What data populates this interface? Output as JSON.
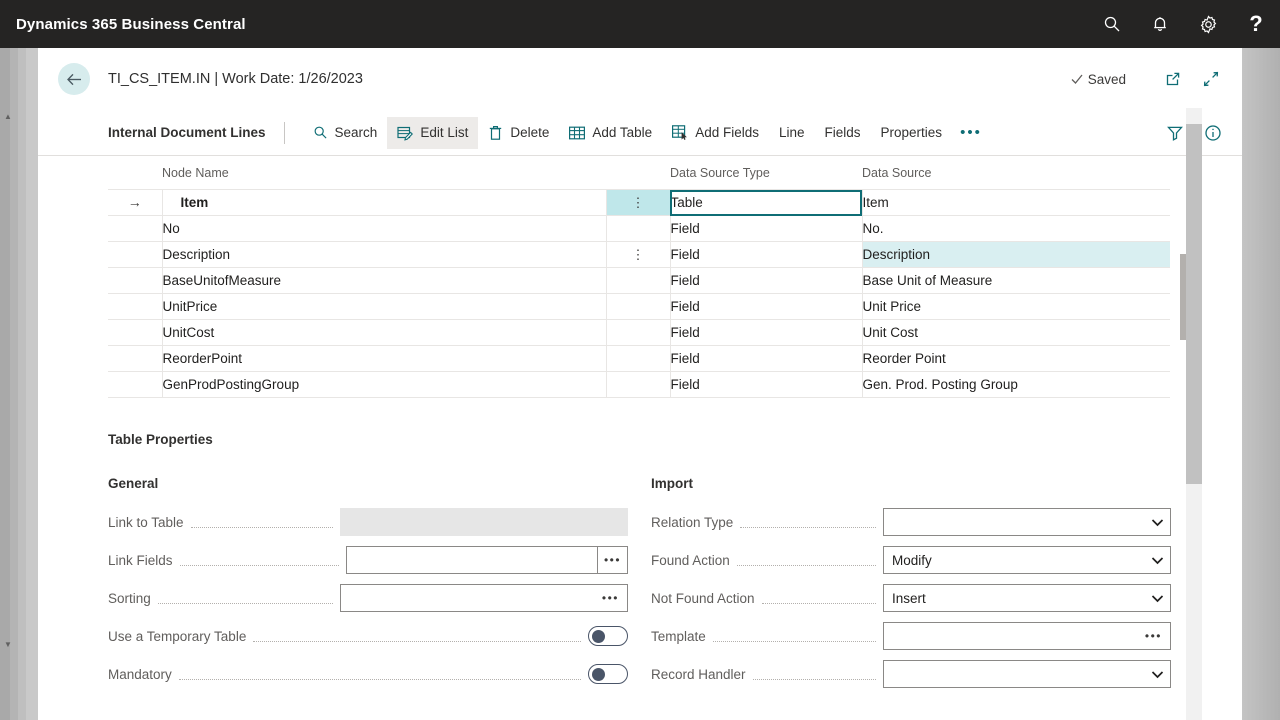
{
  "app": {
    "title": "Dynamics 365 Business Central",
    "actions": [
      {
        "name": "search-icon",
        "label": "Search"
      },
      {
        "name": "notification-bell-icon",
        "label": "Notifications"
      },
      {
        "name": "settings-gear-icon",
        "label": "Settings"
      },
      {
        "name": "help-icon",
        "label": "?"
      }
    ]
  },
  "header": {
    "back_label": "Back",
    "caption": "TI_CS_ITEM.IN | Work Date: 1/26/2023",
    "saved_label": "Saved",
    "open_new_window_label": "Open in new window",
    "collapse_label": "Collapse"
  },
  "ribbon": {
    "title": "Internal Document Lines",
    "items": [
      {
        "label": "Search",
        "icon": "search-icon",
        "active": false
      },
      {
        "label": "Edit List",
        "icon": "edit-list-icon",
        "active": true
      },
      {
        "label": "Delete",
        "icon": "trash-icon",
        "active": false
      },
      {
        "label": "Add Table",
        "icon": "table-grid-icon",
        "active": false
      },
      {
        "label": "Add Fields",
        "icon": "add-fields-icon",
        "active": false
      },
      {
        "label": "Line",
        "icon": "",
        "active": false
      },
      {
        "label": "Fields",
        "icon": "",
        "active": false
      },
      {
        "label": "Properties",
        "icon": "",
        "active": false
      }
    ],
    "overflow_label": "•••",
    "filter_label": "Filter",
    "info_label": "Info"
  },
  "grid": {
    "columns": [
      "Node Name",
      "Data Source Type",
      "Data Source"
    ],
    "rows": [
      {
        "node": "Item",
        "type": "Table",
        "source": "Item",
        "level": 0,
        "selected": true,
        "kebab": true,
        "type_focus": true,
        "source_hl": false
      },
      {
        "node": "No",
        "type": "Field",
        "source": "No.",
        "level": 1,
        "selected": false,
        "kebab": false,
        "type_focus": false,
        "source_hl": false
      },
      {
        "node": "Description",
        "type": "Field",
        "source": "Description",
        "level": 1,
        "selected": false,
        "kebab": true,
        "type_focus": false,
        "source_hl": true
      },
      {
        "node": "BaseUnitofMeasure",
        "type": "Field",
        "source": "Base Unit of Measure",
        "level": 1,
        "selected": false,
        "kebab": false,
        "type_focus": false,
        "source_hl": false
      },
      {
        "node": "UnitPrice",
        "type": "Field",
        "source": "Unit Price",
        "level": 1,
        "selected": false,
        "kebab": false,
        "type_focus": false,
        "source_hl": false
      },
      {
        "node": "UnitCost",
        "type": "Field",
        "source": "Unit Cost",
        "level": 1,
        "selected": false,
        "kebab": false,
        "type_focus": false,
        "source_hl": false
      },
      {
        "node": "ReorderPoint",
        "type": "Field",
        "source": "Reorder Point",
        "level": 1,
        "selected": false,
        "kebab": false,
        "type_focus": false,
        "source_hl": false
      },
      {
        "node": "GenProdPostingGroup",
        "type": "Field",
        "source": "Gen. Prod. Posting Group",
        "level": 1,
        "selected": false,
        "kebab": false,
        "type_focus": false,
        "source_hl": false
      }
    ]
  },
  "properties": {
    "title": "Table Properties",
    "general": {
      "heading": "General",
      "link_to_table": {
        "label": "Link to Table",
        "value": "",
        "disabled": true
      },
      "link_fields": {
        "label": "Link Fields",
        "value": "",
        "ellipsis": "•••"
      },
      "sorting": {
        "label": "Sorting",
        "value": "",
        "ellipsis": "•••"
      },
      "use_temporary_table": {
        "label": "Use a Temporary Table",
        "value": "off"
      },
      "mandatory": {
        "label": "Mandatory",
        "value": "off"
      }
    },
    "import": {
      "heading": "Import",
      "relation_type": {
        "label": "Relation Type",
        "value": ""
      },
      "found_action": {
        "label": "Found Action",
        "value": "Modify"
      },
      "not_found_action": {
        "label": "Not Found Action",
        "value": "Insert"
      },
      "template": {
        "label": "Template",
        "value": "",
        "ellipsis": "•••"
      },
      "record_handler": {
        "label": "Record Handler",
        "value": ""
      }
    }
  },
  "colors": {
    "appbar": "#252423",
    "accent_teal": "#0f6d75",
    "selection_cyan": "#bfe7ea",
    "row_highlight": "#d9eff1"
  }
}
